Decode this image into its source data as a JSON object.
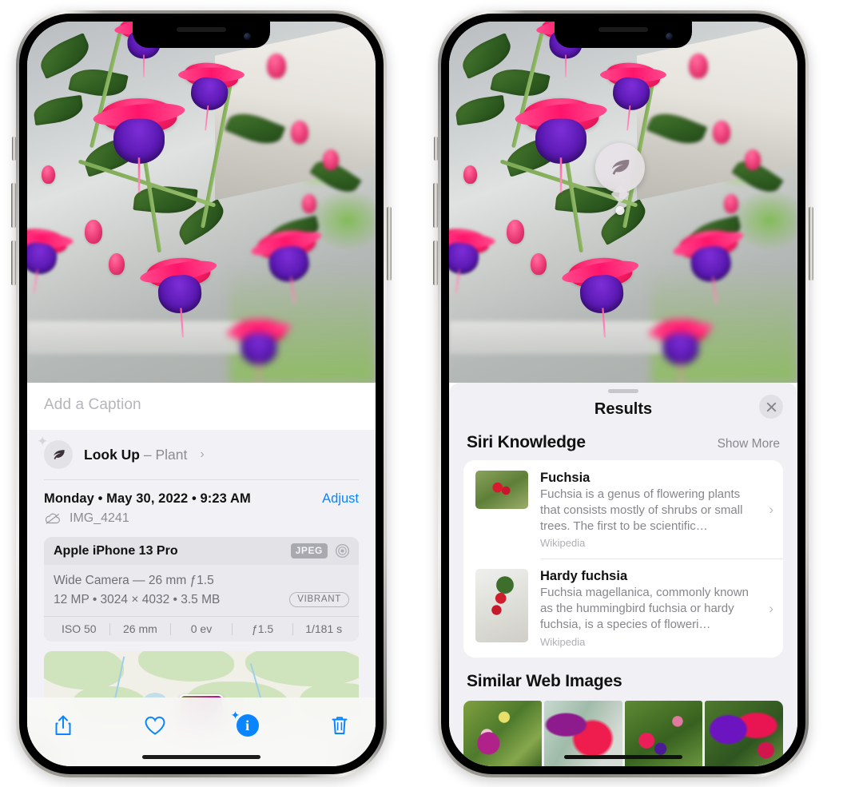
{
  "left_phone": {
    "photo": {
      "alt_name": "fuchsia-flowers-photo"
    },
    "caption": {
      "placeholder": "Add a Caption",
      "value": ""
    },
    "look_up": {
      "icon": "leaf-icon",
      "label": "Look Up",
      "dash": " – ",
      "subject": "Plant",
      "chevron": "›"
    },
    "metadata": {
      "date_line": "Monday • May 30, 2022 • 9:23 AM",
      "adjust_label": "Adjust",
      "cloud_icon": "cloud-slash-icon",
      "filename": "IMG_4241"
    },
    "camera_card": {
      "device": "Apple iPhone 13 Pro",
      "format_badge": "JPEG",
      "hdr_icon": "hdr-aperture-icon",
      "lens_line": "Wide Camera — 26 mm ƒ1.5",
      "size_line": "12 MP • 3024 × 4032 • 3.5 MB",
      "style_badge": "VIBRANT",
      "exif": [
        "ISO 50",
        "26 mm",
        "0 ev",
        "ƒ1.5",
        "1/181 s"
      ]
    },
    "map": {
      "name": "location-map-thumbnail"
    },
    "toolbar": {
      "share_icon": "share-icon",
      "favorite_icon": "heart-icon",
      "info_icon": "info-sparkle-icon",
      "info_glyph": "i",
      "delete_icon": "trash-icon"
    }
  },
  "right_phone": {
    "pin": {
      "icon": "leaf-icon",
      "name": "visual-look-up-pin"
    },
    "sheet": {
      "title": "Results",
      "close_icon": "close-icon"
    },
    "siri_knowledge": {
      "section_title": "Siri Knowledge",
      "show_more": "Show More",
      "items": [
        {
          "title": "Fuchsia",
          "description": "Fuchsia is a genus of flowering plants that consists mostly of shrubs or small trees. The first to be scientific…",
          "source": "Wikipedia",
          "chevron": "›"
        },
        {
          "title": "Hardy fuchsia",
          "description": "Fuchsia magellanica, commonly known as the hummingbird fuchsia or hardy fuchsia, is a species of floweri…",
          "source": "Wikipedia",
          "chevron": "›"
        }
      ]
    },
    "similar_web_images": {
      "section_title": "Similar Web Images",
      "thumbnails": [
        "web-image-1",
        "web-image-2",
        "web-image-3",
        "web-image-4"
      ]
    }
  },
  "colors": {
    "accent_blue": "#0a84ff",
    "sheet_bg": "#f1f1f5",
    "info_bg": "#f2f2f6",
    "card_bg": "#ffffff",
    "muted_text": "#86868d"
  }
}
